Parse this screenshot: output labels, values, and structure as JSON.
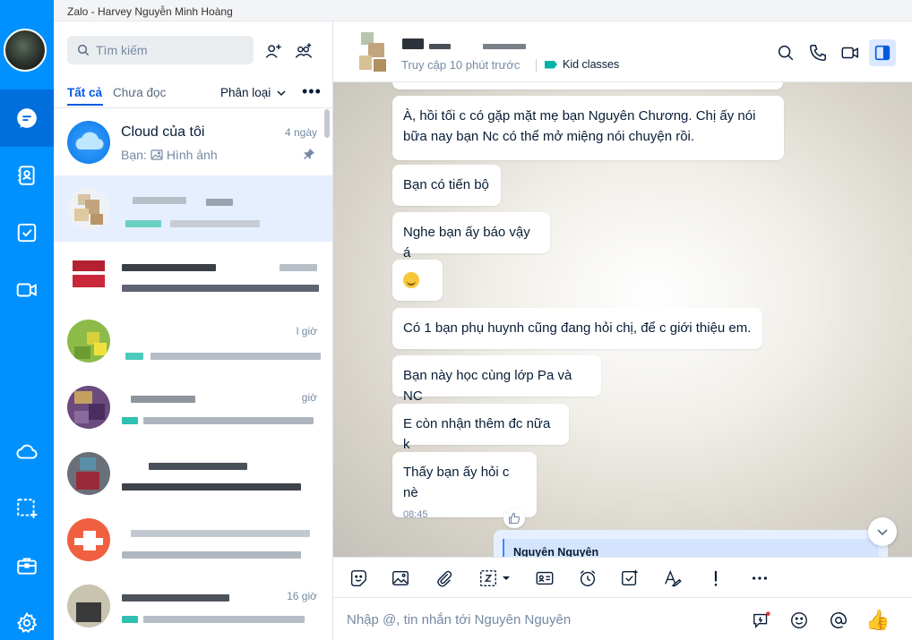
{
  "window": {
    "title": "Zalo - Harvey  Nguyễn Minh Hoàng"
  },
  "colors": {
    "accent": "#0091ff",
    "rail_active": "#006edc",
    "selected_row": "#e5efff",
    "tag": "#00b3a6"
  },
  "rail": {
    "items": [
      {
        "icon": "chat-icon",
        "active": true
      },
      {
        "icon": "contacts-icon",
        "active": false
      },
      {
        "icon": "todo-icon",
        "active": false
      },
      {
        "icon": "video-call-icon",
        "active": false
      },
      {
        "icon": "cloud-icon",
        "active": false
      },
      {
        "icon": "screenshot-icon",
        "active": false
      },
      {
        "icon": "toolbox-icon",
        "active": false
      },
      {
        "icon": "settings-icon",
        "active": false
      }
    ]
  },
  "sidebar": {
    "search_placeholder": "Tìm kiếm",
    "tabs": {
      "all": "Tất cả",
      "unread": "Chưa đọc"
    },
    "classify_label": "Phân loại",
    "conversations": [
      {
        "name": "Cloud của tôi",
        "time": "4 ngày",
        "preview_prefix": "Bạn:",
        "preview_text": "Hình ảnh",
        "pinned": true
      },
      {
        "name": "",
        "time": "",
        "preview": ""
      },
      {
        "name": "",
        "time": "",
        "preview": ""
      },
      {
        "name": "",
        "time": "l giờ",
        "preview": ""
      },
      {
        "name": "",
        "time": "giờ",
        "preview": ""
      },
      {
        "name": "",
        "time": "",
        "preview": ""
      },
      {
        "name": "",
        "time": "",
        "preview": ""
      },
      {
        "name": "",
        "time": "16 giờ",
        "preview": ""
      }
    ]
  },
  "chat": {
    "header": {
      "status": "Truy cập 10 phút trước",
      "tag": "Kid classes"
    },
    "messages": [
      {
        "text": "À, hồi tối c có gặp mặt mẹ bạn Nguyên Chương. Chị ấy nói bữa nay bạn Nc có thể mở miệng nói chuyện rồi."
      },
      {
        "text": "Bạn có tiến bộ"
      },
      {
        "text": "Nghe bạn ấy báo vậy á"
      },
      {
        "text": "",
        "emoji": "smiling-face"
      },
      {
        "text": "Có 1 bạn phụ huynh cũng đang hỏi chị, để c giới thiệu em."
      },
      {
        "text": "Bạn này học cùng lớp Pa và NC"
      },
      {
        "text": "E còn nhận thêm đc nữa k"
      },
      {
        "text": "Thấy bạn ấy hỏi c nè",
        "time": "08:45"
      }
    ],
    "quote_name": "Nguyên Nguyên",
    "composer_placeholder": "Nhập @, tin nhắn tới Nguyên Nguyên"
  }
}
